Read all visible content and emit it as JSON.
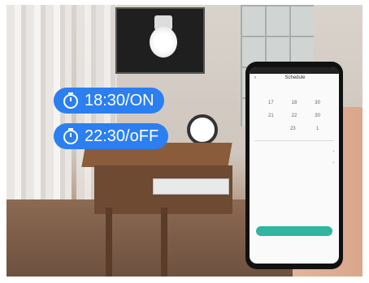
{
  "overlay": {
    "timers": [
      {
        "time": "18:30/ON",
        "icon": "stopwatch-icon"
      },
      {
        "time": "22:30/oFF",
        "icon": "stopwatch-icon"
      }
    ],
    "pill_color": "#2b7ff0"
  },
  "phone": {
    "accent": "#2fb5a0",
    "title": "Schedule",
    "rows": [
      [
        "17",
        "18",
        "30"
      ],
      [
        "21",
        "22",
        "30"
      ],
      [
        "",
        "23",
        "1"
      ]
    ]
  }
}
